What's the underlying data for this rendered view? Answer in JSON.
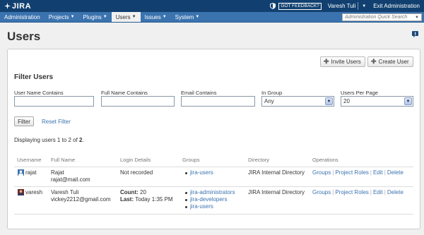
{
  "topbar": {
    "logo": "JIRA",
    "feedback": "GOT FEEDBACK?",
    "user": "Varesh Tuli",
    "exit": "Exit Administration"
  },
  "nav": {
    "items": [
      "Administration",
      "Projects",
      "Plugins",
      "Users",
      "Issues",
      "System"
    ],
    "search_placeholder": "Administration Quick Search"
  },
  "page": {
    "title": "Users"
  },
  "actions": {
    "invite": "Invite Users",
    "create": "Create User"
  },
  "filter": {
    "title": "Filter Users",
    "username_label": "User Name Contains",
    "username_value": "",
    "fullname_label": "Full Name Contains",
    "fullname_value": "",
    "email_label": "Email Contains",
    "email_value": "",
    "group_label": "In Group",
    "group_value": "Any",
    "perpage_label": "Users Per Page",
    "perpage_value": "20",
    "filter_button": "Filter",
    "reset": "Reset Filter"
  },
  "results": {
    "prefix": "Displaying users 1 to 2 of ",
    "total": "2",
    "suffix": "."
  },
  "table": {
    "headers": [
      "Username",
      "Full Name",
      "Login Details",
      "Groups",
      "Directory",
      "Operations"
    ],
    "rows": [
      {
        "username": "rajat",
        "fullname": "Rajat",
        "email": "rajat@mail.com",
        "login": "Not recorded",
        "groups": [
          "jira-users"
        ],
        "directory": "JIRA Internal Directory",
        "ops": [
          "Groups",
          "Project Roles",
          "Edit",
          "Delete"
        ]
      },
      {
        "username": "varesh",
        "fullname": "Varesh Tuli",
        "email": "vickey2212@gmail.com",
        "count_label": "Count:",
        "count_value": "20",
        "last_label": "Last:",
        "last_value": "Today 1:35 PM",
        "groups": [
          "jira-administrators",
          "jira-developers",
          "jira-users"
        ],
        "directory": "JIRA Internal Directory",
        "ops": [
          "Groups",
          "Project Roles",
          "Edit",
          "Delete"
        ]
      }
    ]
  }
}
